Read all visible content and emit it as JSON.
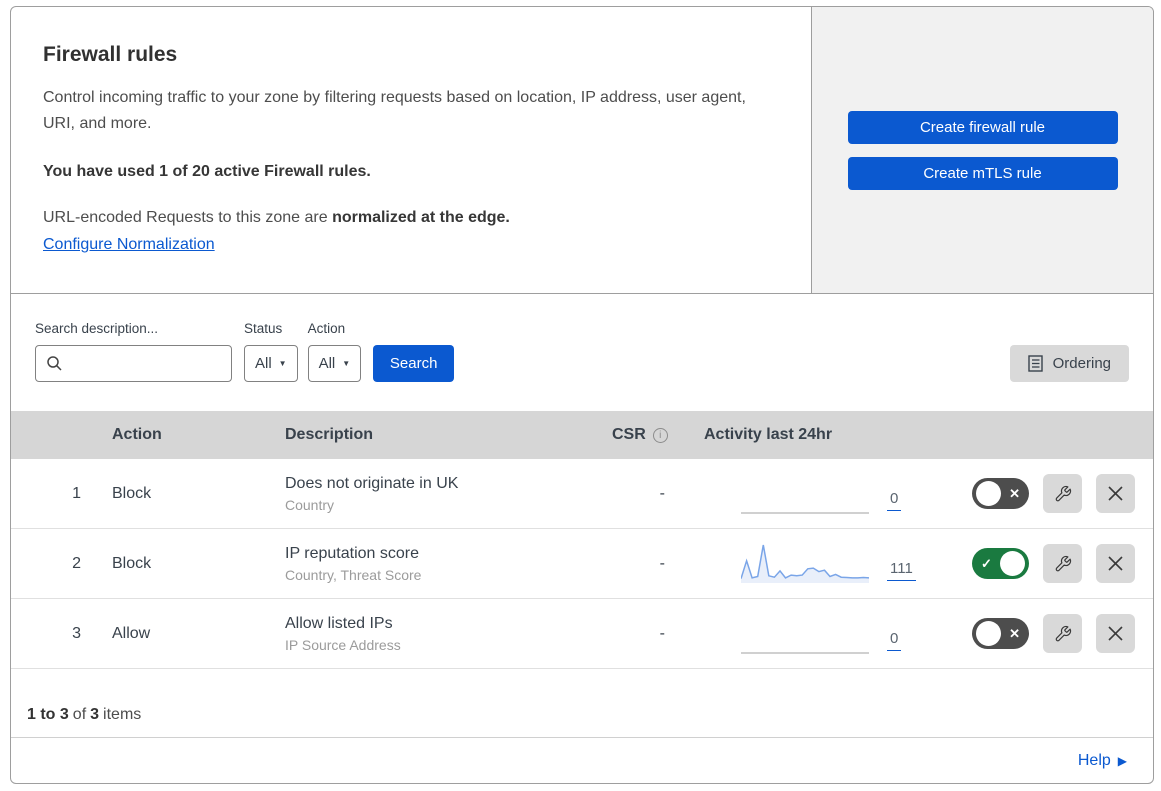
{
  "colors": {
    "primary_blue": "#0b59d0",
    "link_blue": "#0b59d0",
    "toggle_on_green": "#1a7a40",
    "toggle_off_gray": "#4d4d4d",
    "sparkline_line": "#7aa5e8",
    "sparkline_fill": "#e9effa",
    "sparkline_flat": "#b5b5b5",
    "table_header_bg": "#d6d6d6",
    "side_panel_bg": "#f1f1f1",
    "icon_button_bg": "#d9d9d9"
  },
  "intro": {
    "title": "Firewall rules",
    "description": "Control incoming traffic to your zone by filtering requests based on location, IP address, user agent, URI, and more.",
    "usage": "You have used 1 of 20 active Firewall rules.",
    "normalization_prefix": "URL-encoded Requests to this zone are ",
    "normalization_bold": "normalized at the edge.",
    "normalization_link": "Configure Normalization",
    "create_firewall_button": "Create firewall rule",
    "create_mtls_button": "Create mTLS rule"
  },
  "filters": {
    "search_label": "Search description...",
    "search_value": "",
    "status_label": "Status",
    "status_value": "All",
    "action_label": "Action",
    "action_value": "All",
    "search_button": "Search",
    "ordering_button": "Ordering"
  },
  "table": {
    "headers": {
      "action": "Action",
      "description": "Description",
      "csr": "CSR",
      "activity": "Activity last 24hr"
    },
    "rows": [
      {
        "num": "1",
        "action": "Block",
        "description": "Does not originate in UK",
        "fields": "Country",
        "csr": "-",
        "count": "0",
        "enabled": false,
        "sparkline": []
      },
      {
        "num": "2",
        "action": "Block",
        "description": "IP reputation score",
        "fields": "Country, Threat Score",
        "csr": "-",
        "count": "111",
        "enabled": true,
        "sparkline": [
          4,
          55,
          6,
          10,
          100,
          12,
          8,
          26,
          6,
          14,
          12,
          14,
          32,
          34,
          24,
          28,
          10,
          16,
          8,
          7,
          6,
          6,
          7,
          6
        ]
      },
      {
        "num": "3",
        "action": "Allow",
        "description": "Allow listed IPs",
        "fields": "IP Source Address",
        "csr": "-",
        "count": "0",
        "enabled": false,
        "sparkline": []
      }
    ]
  },
  "footer": {
    "range": "1 to 3",
    "of_word": "of",
    "total": "3",
    "items_word": "items"
  },
  "help": {
    "label": "Help"
  },
  "glyphs": {
    "toggle_on": "✓",
    "toggle_off": "✕",
    "caret": "▼",
    "help_arrow": "▶",
    "info": "i"
  }
}
